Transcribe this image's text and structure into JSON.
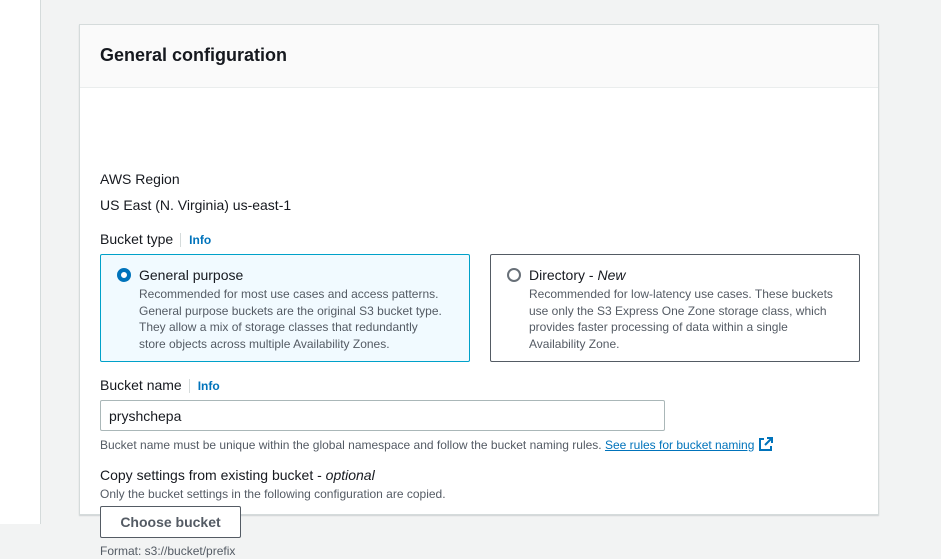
{
  "section": {
    "title": "General configuration"
  },
  "region": {
    "label": "AWS Region",
    "value": "US East (N. Virginia) us-east-1"
  },
  "bucket_type": {
    "label": "Bucket type",
    "info": "Info",
    "options": [
      {
        "title": "General purpose",
        "desc_lines": [
          "Recommended for most use cases and access patterns.",
          "General purpose buckets are the original S3 bucket type.",
          "They allow a mix of storage classes that redundantly",
          "store objects across multiple Availability Zones."
        ],
        "selected": true
      },
      {
        "title": "Directory - ",
        "title_suffix": "New",
        "desc_lines": [
          "Recommended for low-latency use cases. These buckets",
          "use only the S3 Express One Zone storage class, which",
          "provides faster processing of data within a single",
          "Availability Zone."
        ],
        "selected": false
      }
    ]
  },
  "bucket_name": {
    "label": "Bucket name",
    "info": "Info",
    "value": "pryshchepa",
    "hint": "Bucket name must be unique within the global namespace and follow the bucket naming rules.",
    "link": "See rules for bucket naming"
  },
  "copy_settings": {
    "label": "Copy settings from existing bucket - ",
    "label_suffix": "optional",
    "description": "Only the bucket settings in the following configuration are copied.",
    "button": "Choose bucket",
    "format": "Format: s3://bucket/prefix"
  },
  "colors": {
    "link": "#0073bb",
    "selected_border": "#00a1c9",
    "selected_bg": "#f1faff"
  }
}
